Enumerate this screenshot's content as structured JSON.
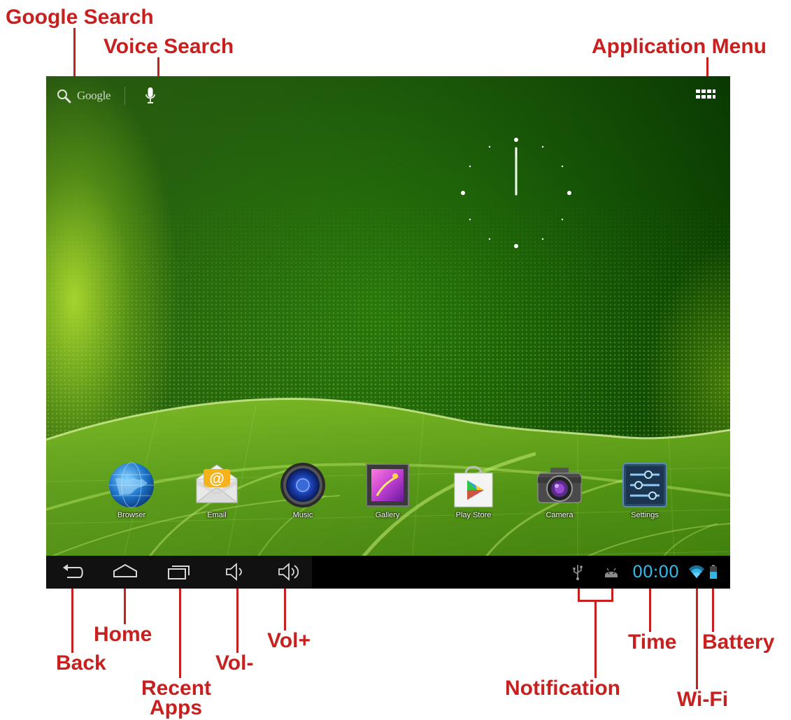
{
  "callouts": {
    "google_search": "Google Search",
    "voice_search": "Voice Search",
    "application_menu": "Application Menu",
    "back": "Back",
    "home": "Home",
    "recent_apps_line1": "Recent",
    "recent_apps_line2": "Apps",
    "vol_minus": "Vol-",
    "vol_plus": "Vol+",
    "notification": "Notification",
    "time": "Time",
    "wifi": "Wi-Fi",
    "battery": "Battery"
  },
  "search": {
    "text": "Google",
    "icon": "search-icon",
    "voice_icon": "microphone-icon"
  },
  "app_menu": {
    "icon": "app-grid-icon"
  },
  "dock": [
    {
      "label": "Browser",
      "icon": "globe-icon"
    },
    {
      "label": "Email",
      "icon": "envelope-icon"
    },
    {
      "label": "Music",
      "icon": "speaker-icon"
    },
    {
      "label": "Gallery",
      "icon": "picture-icon"
    },
    {
      "label": "Play Store",
      "icon": "shopping-bag-icon"
    },
    {
      "label": "Camera",
      "icon": "camera-icon"
    },
    {
      "label": "Settings",
      "icon": "sliders-icon"
    }
  ],
  "navbar": {
    "buttons": [
      "back-icon",
      "home-icon",
      "recent-apps-icon",
      "volume-down-icon",
      "volume-up-icon"
    ],
    "notifications": [
      "usb-icon",
      "android-icon"
    ],
    "time": "00:00",
    "wifi_icon": "wifi-icon",
    "battery_icon": "battery-icon"
  },
  "colors": {
    "callout": "#c8201e",
    "clock_text": "#33b5e5",
    "navbar": "#000000",
    "wallpaper": "#1b6d05"
  }
}
